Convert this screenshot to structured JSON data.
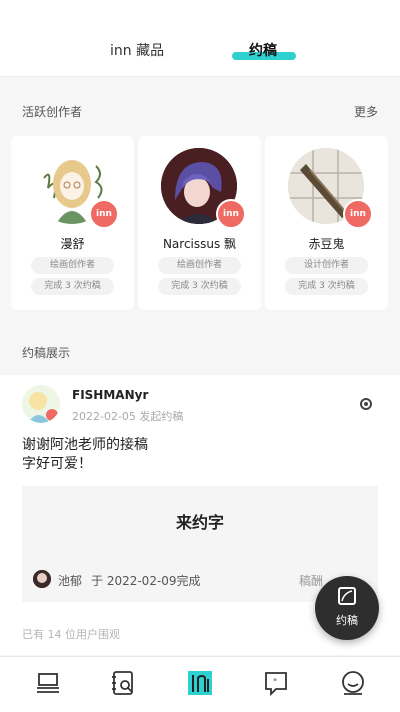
{
  "tabs": {
    "collect": "inn 藏品",
    "commission": "约稿"
  },
  "creators_section": {
    "title": "活跃创作者",
    "more": "更多"
  },
  "badge_text": "inn",
  "creators": [
    {
      "name": "漫舒",
      "role": "绘画创作者",
      "completed": "完成 3 次约稿"
    },
    {
      "name": "Narcissus 飘",
      "role": "绘画创作者",
      "completed": "完成 3 次约稿"
    },
    {
      "name": "赤豆鬼",
      "role": "设计创作者",
      "completed": "完成 3 次约稿"
    }
  ],
  "showcase": {
    "title": "约稿展示",
    "post": {
      "author": "FISHMANyr",
      "date": "2022-02-05 发起约稿",
      "text_line1": "谢谢阿池老师的接稿",
      "text_line2": "字好可爱！",
      "quote_title": "来约字",
      "artist": "池郁",
      "completed_on": "于 2022-02-09完成",
      "fee": "稿酬",
      "views": "已有 14 位用户围观"
    }
  },
  "fab": {
    "label": "约稿"
  },
  "colors": {
    "accent": "#2fd0d0",
    "badge": "#ee6a63",
    "fab": "#2e2e2e"
  },
  "nav_icons": [
    "home-icon",
    "notebook-search-icon",
    "inn-logo-icon",
    "quote-chat-icon",
    "face-profile-icon"
  ]
}
